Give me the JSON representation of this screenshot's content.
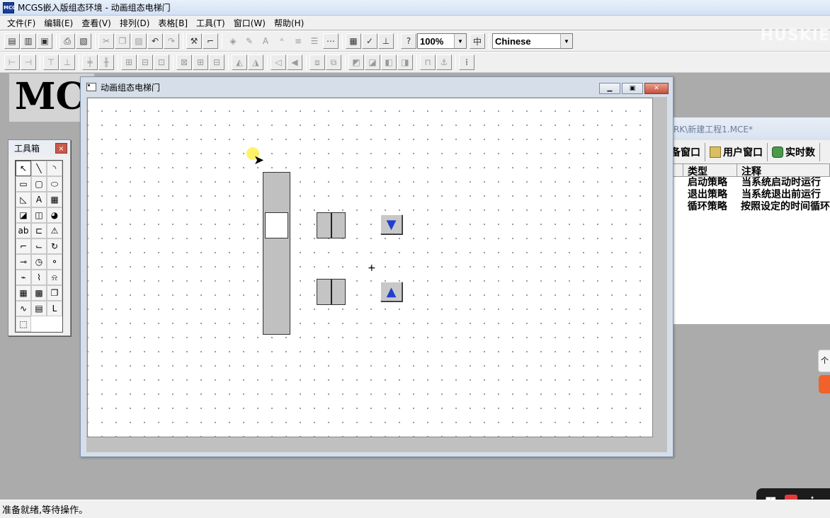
{
  "app": {
    "title": "MCGS嵌入版组态环境 - 动画组态电梯门",
    "logo": "MCGS"
  },
  "menu": [
    "文件(F)",
    "编辑(E)",
    "查看(V)",
    "排列(D)",
    "表格[B]",
    "工具(T)",
    "窗口(W)",
    "帮助(H)"
  ],
  "toolbar": {
    "zoom": "100%",
    "language": "Chinese"
  },
  "watermark": "HUSKIE",
  "background_logo": "MC",
  "workspace": {
    "title": "RK\\新建工程1.MCE*",
    "tabs": [
      "备窗口",
      "用户窗口",
      "实时数"
    ],
    "columns": [
      "类型",
      "注释"
    ],
    "rows": [
      {
        "type": "启动策略",
        "note": "当系统启动时运行"
      },
      {
        "type": "退出策略",
        "note": "当系统退出前运行"
      },
      {
        "type": "循环策略",
        "note": "按照设定的时间循环"
      }
    ]
  },
  "toolbox": {
    "title": "工具箱",
    "close": "×"
  },
  "editor": {
    "title": "动画组态电梯门"
  },
  "canvas": {
    "down_arrow": "▼",
    "up_arrow": "▲"
  },
  "status": {
    "text": "准备就绪,等待操作。"
  },
  "colors": {
    "arrow_blue": "#1f3fd0",
    "record_red": "#e53a3a",
    "orange": "#f0622a"
  }
}
